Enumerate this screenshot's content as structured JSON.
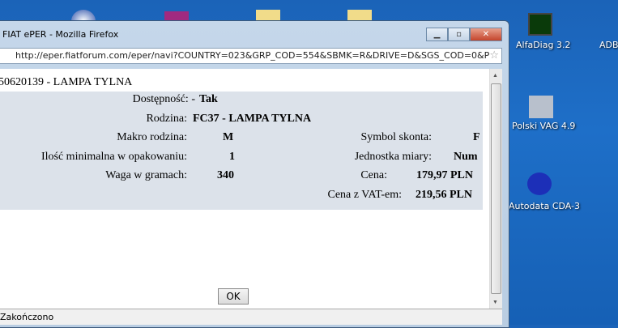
{
  "desktop": {
    "icons": [
      {
        "label": "AlfaDiag 3.2"
      },
      {
        "label": "ADB"
      },
      {
        "label": "Polski VAG 4.9"
      },
      {
        "label": "Autodata CDA-3"
      }
    ]
  },
  "window": {
    "title": "FIAT ePER - Mozilla Firefox",
    "url": "http://eper.fiatforum.com/eper/navi?COUNTRY=023&GRP_COD=554&SBMK=R&DRIVE=D&SGS_COD=0&P"
  },
  "page": {
    "heading": "50620139 - LAMPA TYLNA",
    "availability_label": "Dostępność: -",
    "availability_value": "Tak",
    "family_label": "Rodzina:",
    "family_value": "FC37 - LAMPA TYLNA",
    "macro_label": "Makro rodzina:",
    "macro_value": "M",
    "discount_label": "Symbol skonta:",
    "discount_value": "F",
    "minqty_label": "Ilość minimalna w opakowaniu:",
    "minqty_value": "1",
    "unit_label": "Jednostka miary:",
    "unit_value": "Num",
    "weight_label": "Waga w gramach:",
    "weight_value": "340",
    "price_label": "Cena:",
    "price_value": "179,97 PLN",
    "vat_label": "Cena z VAT-em:",
    "vat_value": "219,56 PLN",
    "ok": "OK"
  },
  "status": "Zakończono"
}
